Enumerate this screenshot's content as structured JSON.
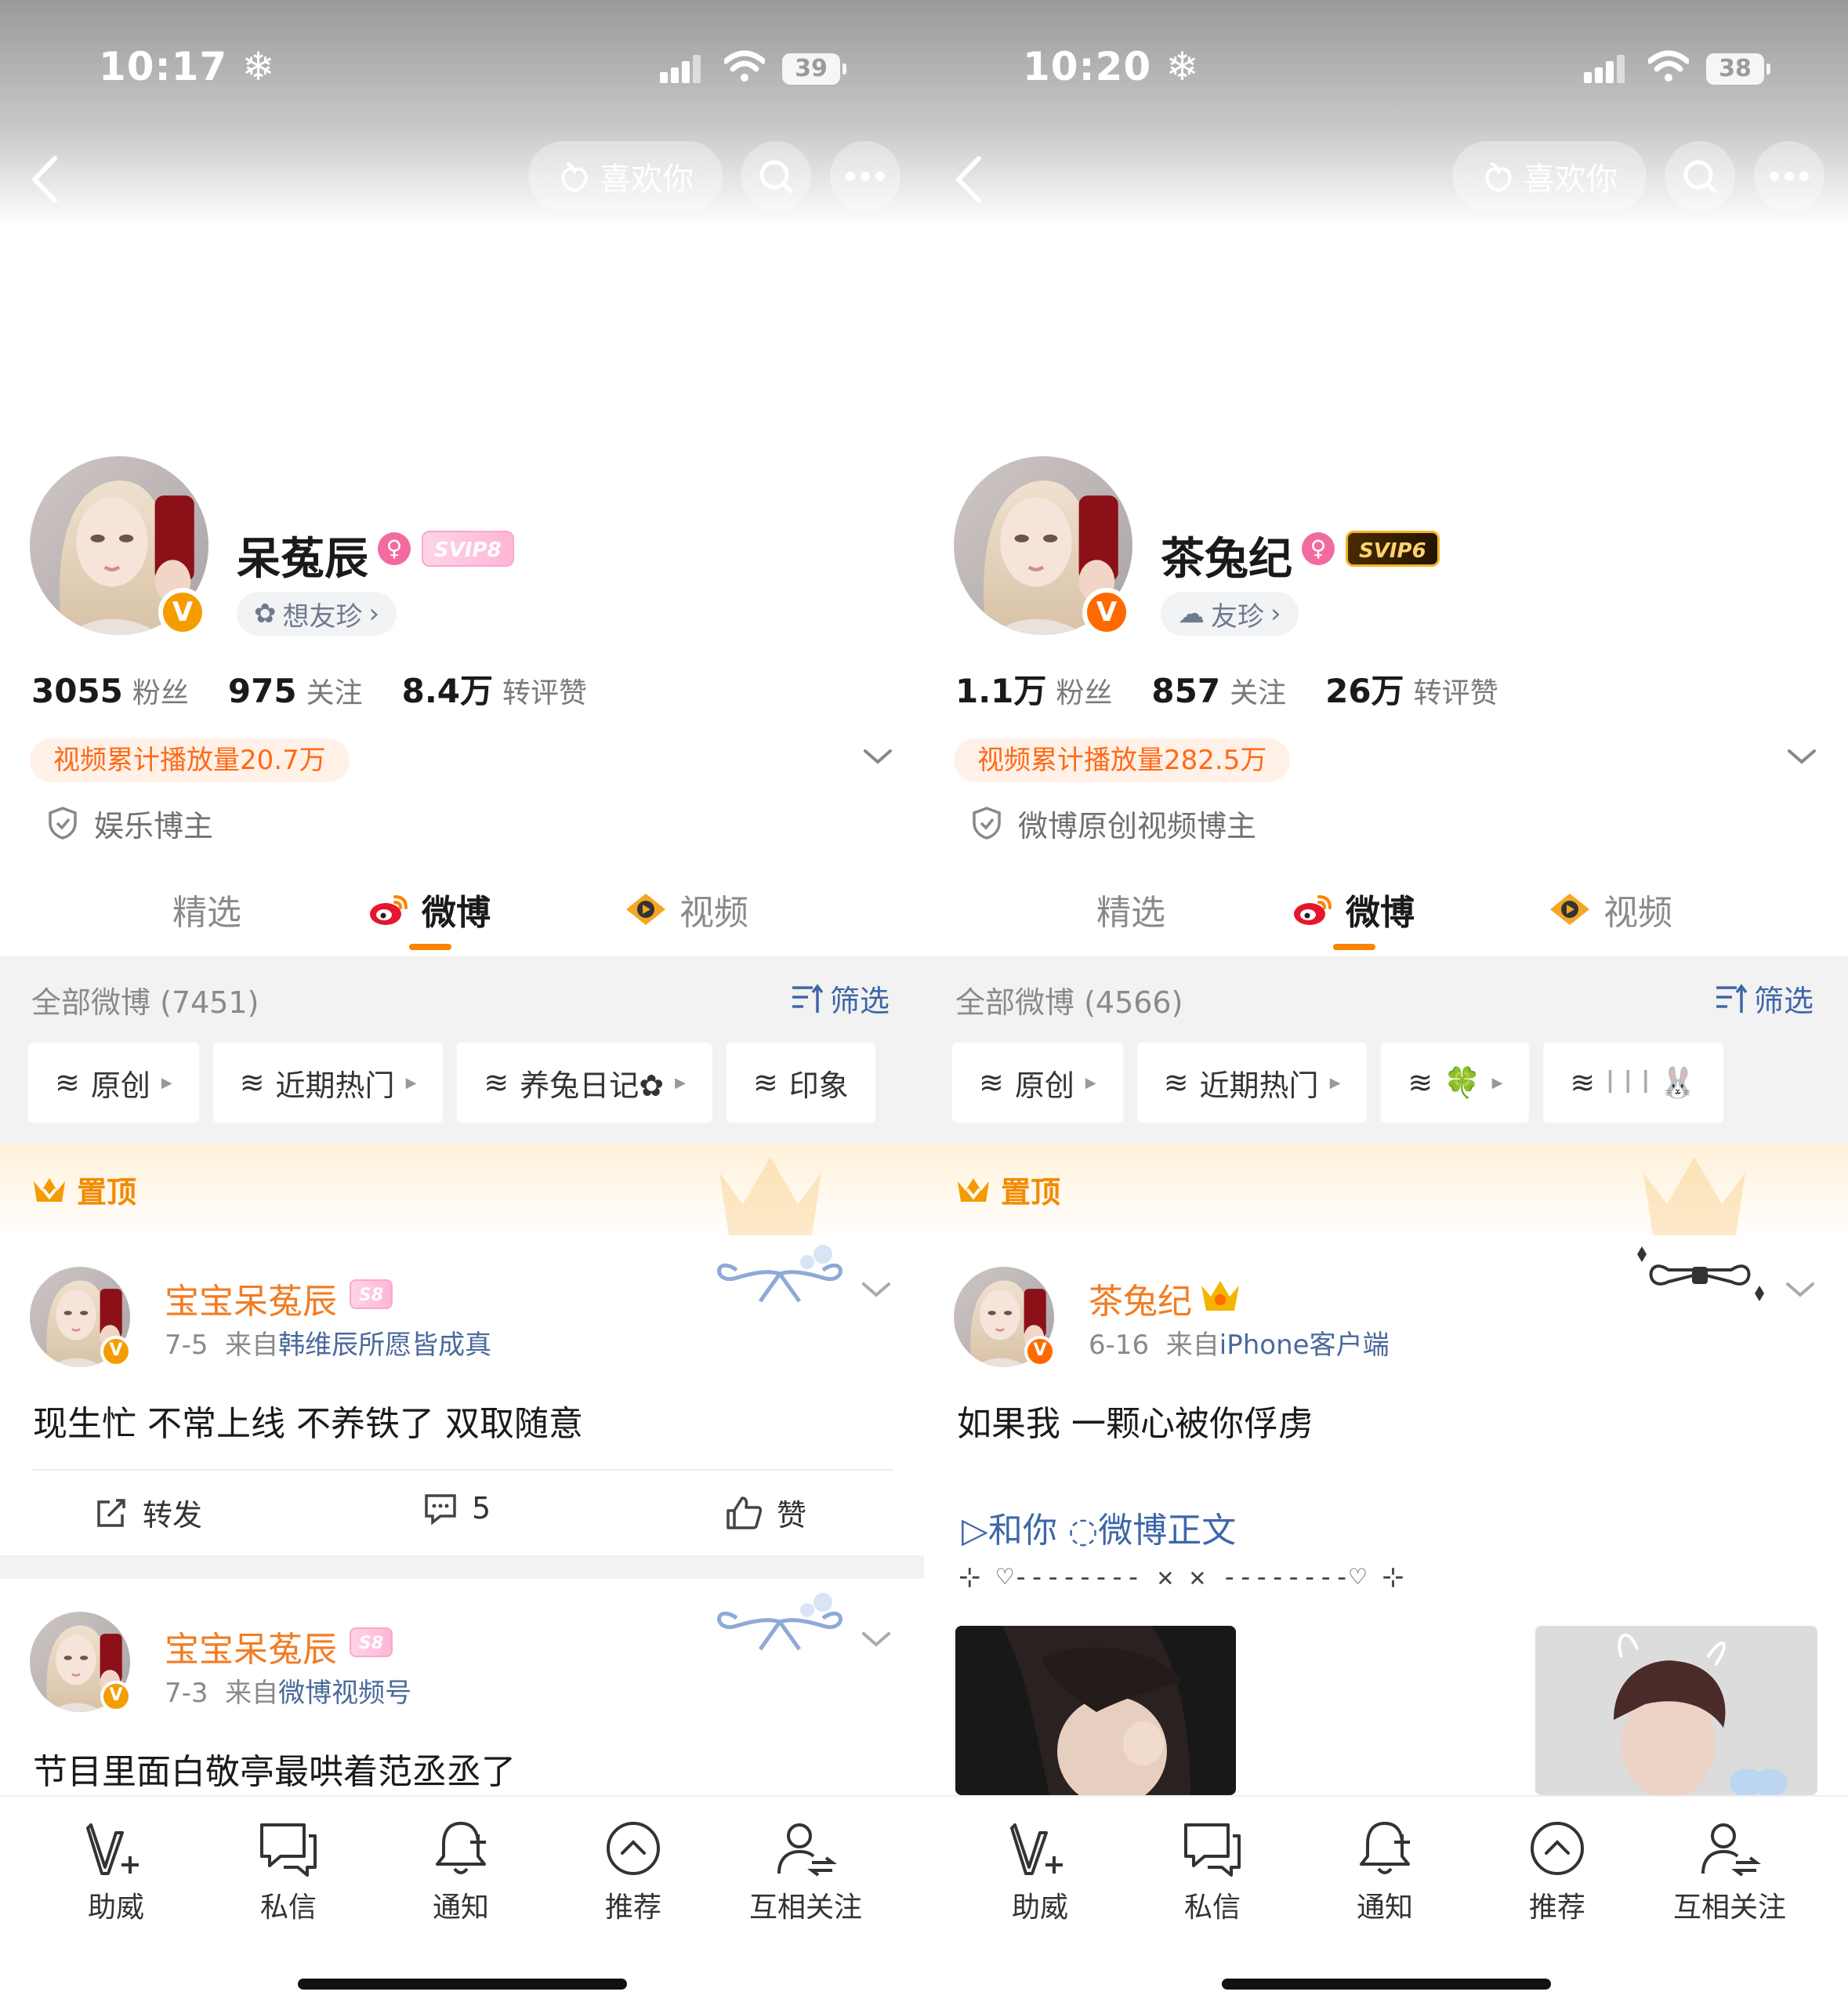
{
  "left": {
    "status": {
      "time": "10:17 ❄",
      "battery": "39"
    },
    "nav": {
      "like_label": "喜欢你"
    },
    "profile": {
      "name": "呆菟辰",
      "svip": "SVIP8",
      "friend_tag": "想友珍",
      "stats": [
        {
          "num": "3055",
          "label": "粉丝"
        },
        {
          "num": "975",
          "label": "关注"
        },
        {
          "num": "8.4万",
          "label": "转评赞"
        }
      ],
      "video_pill": "视频累计播放量20.7万",
      "role": "娱乐博主"
    },
    "tabs": [
      "精选",
      "微博",
      "视频"
    ],
    "feed": {
      "header": "全部微博 (7451)",
      "filter": "筛选",
      "chips": [
        "原创",
        "近期热门",
        "养兔日记✿",
        "印象"
      ]
    },
    "pinned": "置顶",
    "posts": [
      {
        "name": "宝宝呆菟辰",
        "badge": "S8",
        "date": "7-5",
        "from": "来自",
        "source": "韩维辰所愿皆成真",
        "text": "现生忙 不常上线 不养铁了 双取随意",
        "repost": "转发",
        "comments": "5",
        "like": "赞"
      },
      {
        "name": "宝宝呆菟辰",
        "badge": "S8",
        "date": "7-3",
        "from": "来自",
        "source": "微博视频号",
        "text": "节目里面白敬亭最哄着范丞丞了"
      }
    ],
    "bottom_nav": [
      "助威",
      "私信",
      "通知",
      "推荐",
      "互相关注"
    ]
  },
  "right": {
    "status": {
      "time": "10:20 ❄",
      "battery": "38"
    },
    "nav": {
      "like_label": "喜欢你"
    },
    "profile": {
      "name": "茶兔纪",
      "svip": "SVIP6",
      "friend_tag": "友珍",
      "stats": [
        {
          "num": "1.1万",
          "label": "粉丝"
        },
        {
          "num": "857",
          "label": "关注"
        },
        {
          "num": "26万",
          "label": "转评赞"
        }
      ],
      "video_pill": "视频累计播放量282.5万",
      "role": "微博原创视频博主"
    },
    "tabs": [
      "精选",
      "微博",
      "视频"
    ],
    "feed": {
      "header": "全部微博 (4566)",
      "filter": "筛选",
      "chips": [
        "原创",
        "近期热门",
        "🍀",
        "l l l 🐰"
      ]
    },
    "pinned": "置顶",
    "posts": [
      {
        "name": "茶兔纪",
        "date": "6-16",
        "from": "来自",
        "source": "iPhone客户端",
        "text": "如果我 一颗心被你俘虏",
        "link_text": "▷和你 ◌微博正文",
        "deco_text": "⊹ ♡-------- ✕ ✕ --------♡ ⊹"
      }
    ],
    "bottom_nav": [
      "助威",
      "私信",
      "通知",
      "推荐",
      "互相关注"
    ]
  },
  "colors": {
    "accent": "#ff8200",
    "name_orange": "#f27c22",
    "link_blue": "#3e67a8",
    "video_pill_text": "#ff6a16"
  }
}
